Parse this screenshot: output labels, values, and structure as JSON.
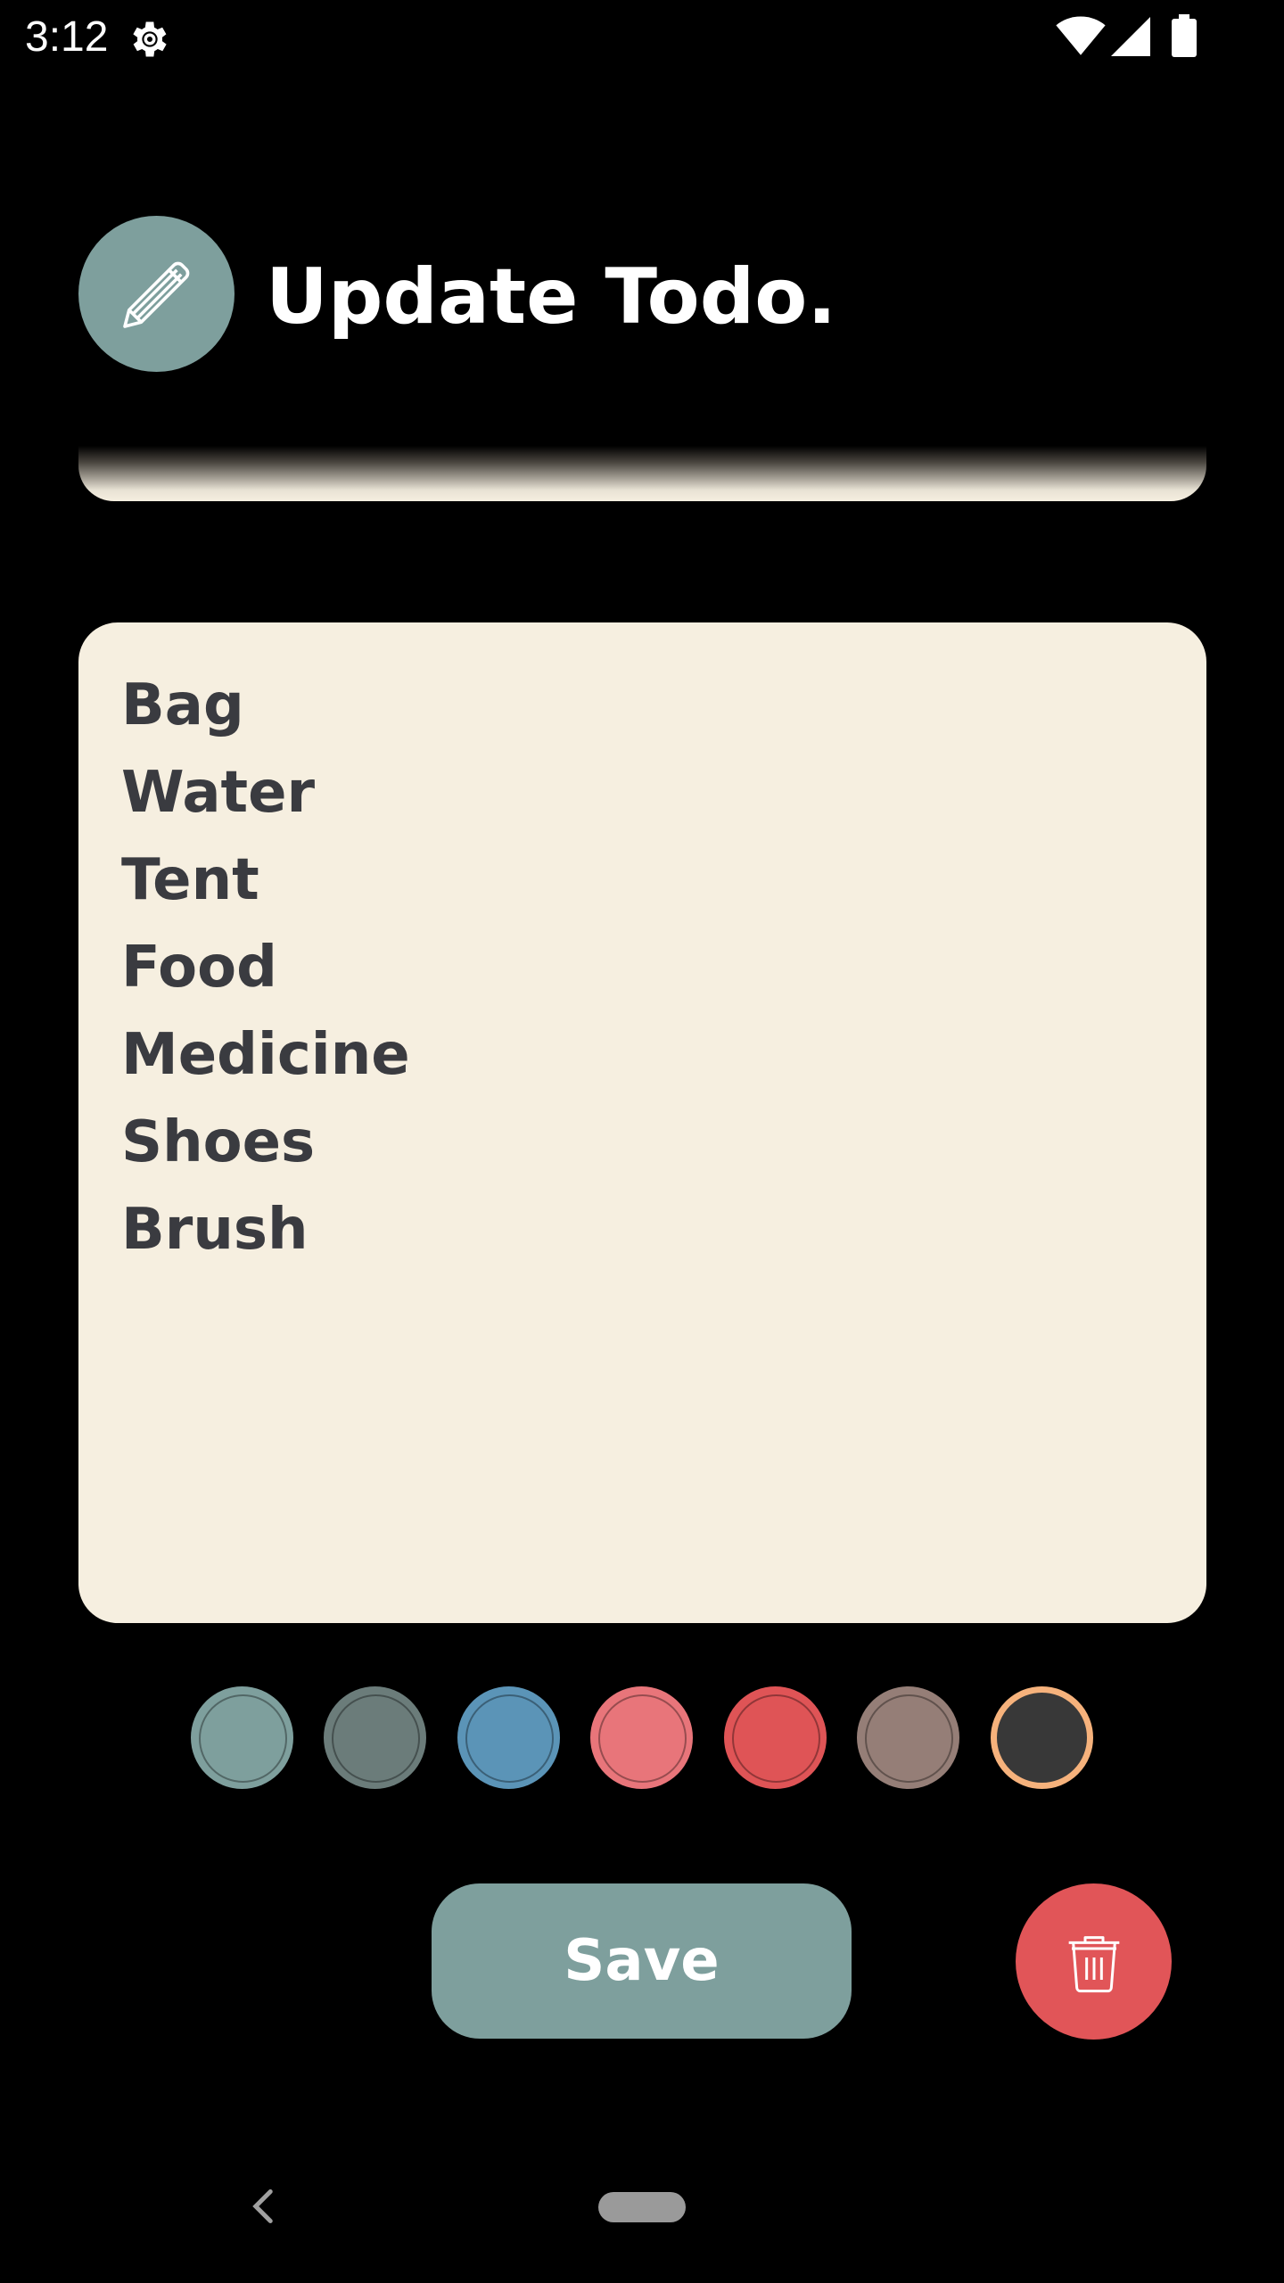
{
  "status_bar": {
    "time": "3:12",
    "icons": [
      "gear-icon",
      "wifi-icon",
      "signal-icon",
      "battery-icon"
    ]
  },
  "header": {
    "icon": "pencil-icon",
    "title": "Update Todo."
  },
  "title_field": {
    "value": ""
  },
  "content": {
    "lines": [
      "Bag",
      "Water",
      "Tent",
      "Food",
      "Medicine",
      "Shoes",
      "Brush"
    ]
  },
  "color_picker": {
    "colors": [
      "#7e9f9d",
      "#6b7c7a",
      "#5b94b7",
      "#e8757a",
      "#df5456",
      "#957e77",
      "#383838"
    ],
    "selected_index": 6,
    "selected_ring_color": "#f6b27c"
  },
  "actions": {
    "save_label": "Save",
    "delete_icon": "trash-icon"
  },
  "colors": {
    "accent": "#7e9f9d",
    "danger": "#e15558",
    "card_background": "#f6efe0",
    "text_dark": "#3a3b40",
    "background": "#000000"
  },
  "nav_bar": {
    "icons": [
      "back-icon",
      "home-pill"
    ]
  }
}
